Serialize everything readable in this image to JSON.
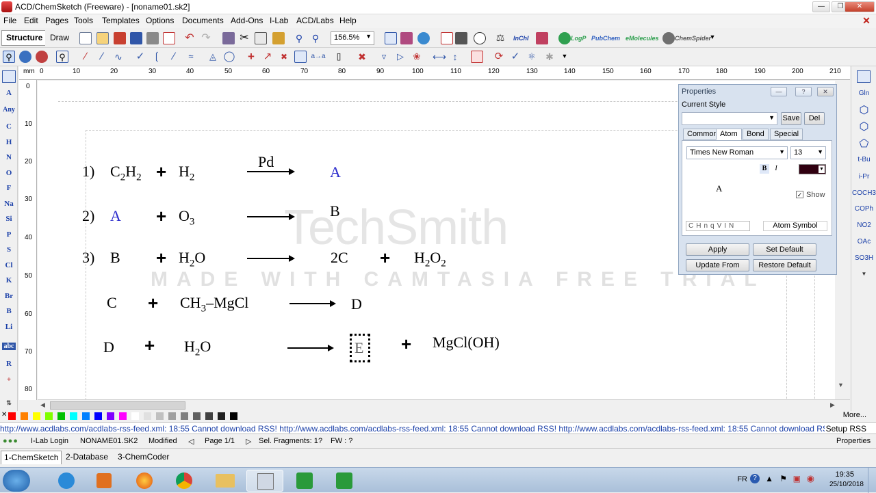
{
  "window": {
    "title": "ACD/ChemSketch (Freeware) - [noname01.sk2]"
  },
  "menu": [
    "File",
    "Edit",
    "Pages",
    "Tools",
    "Templates",
    "Options",
    "Documents",
    "Add-Ons",
    "I-Lab",
    "ACD/Labs",
    "Help"
  ],
  "modes": {
    "structure": "Structure",
    "draw": "Draw"
  },
  "toolbar": {
    "zoom": "156.5%",
    "inchi": "InChI",
    "logp": "LogP",
    "pubchem": "PubChem",
    "emolecules": "eMolecules",
    "chemspider": "ChemSpider"
  },
  "ruler_top": {
    "unit": "mm",
    "ticks": [
      "0",
      "10",
      "20",
      "30",
      "40",
      "50",
      "60",
      "70",
      "80",
      "90",
      "100",
      "110",
      "120",
      "130",
      "140",
      "150",
      "160",
      "170",
      "180",
      "190",
      "200",
      "210"
    ]
  },
  "ruler_left": {
    "ticks": [
      "0",
      "10",
      "20",
      "30",
      "40",
      "50",
      "60",
      "70",
      "80"
    ]
  },
  "left_tools": [
    "A",
    "Any",
    "C",
    "H",
    "N",
    "O",
    "F",
    "Na",
    "Si",
    "P",
    "S",
    "Cl",
    "K",
    "Br",
    "B",
    "Li",
    "abc",
    "R",
    "+"
  ],
  "right_tools": [
    "Gln",
    "t-Bu",
    "i-Pr",
    "COCH3",
    "COPh",
    "NO2",
    "OAc",
    "SO3H"
  ],
  "reactions": {
    "r1_num": "1)",
    "r1_a": "C2H2",
    "r1_b": "H2",
    "r1_cat": "Pd",
    "r1_p": "A",
    "r2_num": "2)",
    "r2_a": "A",
    "r2_b": "O3",
    "r2_p": "B",
    "r3_num": "3)",
    "r3_a": "B",
    "r3_b": "H2O",
    "r3_p1": "2C",
    "r3_p2": "H2O2",
    "r4_a": "C",
    "r4_b": "CH3-MgCl",
    "r4_p": "D",
    "r5_a": "D",
    "r5_b": "H2O",
    "r5_p1": "E",
    "r5_p2": "MgCl(OH)",
    "plus": "+"
  },
  "watermark": {
    "line1": "TechSmith",
    "line2": "MADE WITH CAMTASIA FREE TRIAL"
  },
  "properties": {
    "title": "Properties",
    "current_style": "Current Style",
    "save": "Save",
    "del": "Del",
    "tabs": [
      "Common",
      "Atom",
      "Bond",
      "Special"
    ],
    "font": "Times New Roman",
    "size": "13",
    "bold": "B",
    "italic": "I",
    "preview": "A",
    "show": "Show",
    "atom_symbol": "Atom Symbol",
    "apply": "Apply",
    "set_default": "Set Default",
    "update_from": "Update From",
    "restore_default": "Restore Default",
    "mini_icons": [
      "C",
      "H",
      "n",
      "q",
      "V",
      "I",
      "N"
    ]
  },
  "colors": [
    "#ff0000",
    "#ff8000",
    "#ffff00",
    "#80ff00",
    "#00c000",
    "#00ffff",
    "#0080ff",
    "#0000ff",
    "#8000ff",
    "#ff00ff",
    "#ffffff",
    "#e0e0e0",
    "#c0c0c0",
    "#a0a0a0",
    "#808080",
    "#606060",
    "#404040",
    "#202020",
    "#000000"
  ],
  "more": "More...",
  "rss": "http://www.acdlabs.com/acdlabs-rss-feed.xml: 18:55 Cannot download RSS! http://www.acdlabs.com/acdlabs-rss-feed.xml: 18:55 Cannot download RSS! http://www.acdlabs.com/acdlabs-rss-feed.xml: 18:55 Cannot download RSS! htt",
  "setup_rss": "Setup RSS",
  "status": {
    "ilab": "I-Lab Login",
    "file": "NONAME01.SK2",
    "modified": "Modified",
    "page": "Page 1/1",
    "sel": "Sel. Fragments: 1",
    "q": "?",
    "fw": "FW : ?",
    "properties": "Properties"
  },
  "tabs": [
    "1-ChemSketch",
    "2-Database",
    "3-ChemCoder"
  ],
  "taskbar": {
    "lang": "FR",
    "time": "19:35",
    "date": "25/10/2018"
  }
}
